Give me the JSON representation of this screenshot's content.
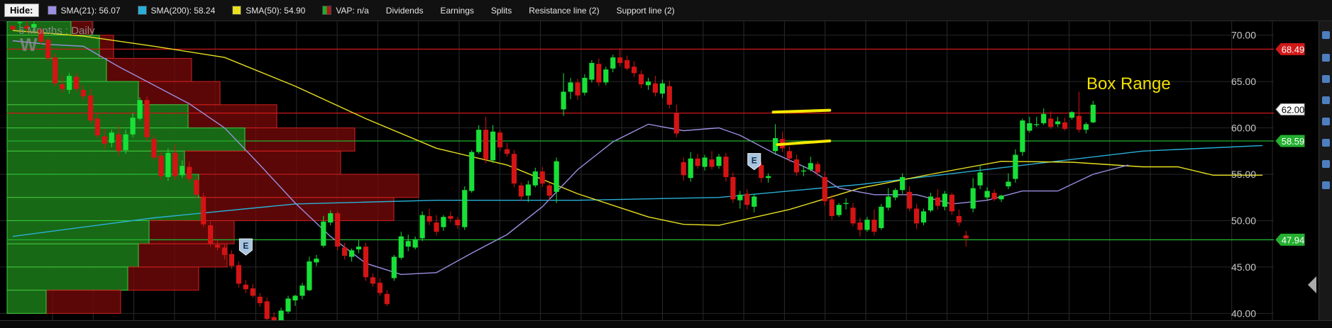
{
  "toolbar": {
    "hide_label": "Hide:",
    "items": [
      {
        "label": "SMA(21): 56.07",
        "color": "#9a8fe0"
      },
      {
        "label": "SMA(200): 58.24",
        "color": "#2ab0d8"
      },
      {
        "label": "SMA(50): 54.90",
        "color": "#e8e020"
      },
      {
        "label": "VAP: n/a",
        "color": "#1fae2a"
      },
      {
        "label": "Dividends"
      },
      {
        "label": "Earnings"
      },
      {
        "label": "Splits"
      },
      {
        "label": "Resistance line (2)"
      },
      {
        "label": "Support line (2)"
      }
    ]
  },
  "chart_data": {
    "type": "candlestick",
    "period_label": "6 Months : Daily",
    "watermark": "W",
    "annotation": "Box Range",
    "earnings_marker_label": "E",
    "ylim": [
      38.5,
      71.5
    ],
    "y_ticks": [
      "70.00",
      "65.00",
      "60.00",
      "55.00",
      "50.00",
      "45.00",
      "40.00"
    ],
    "y_tick_values": [
      70,
      65,
      60,
      55,
      50,
      45,
      40
    ],
    "price_tags": [
      {
        "label": "68.49",
        "value": 68.49,
        "color": "#d01818"
      },
      {
        "label": "62.00",
        "value": 62.0,
        "color": "#ffffff"
      },
      {
        "label": "58.59",
        "value": 58.59,
        "color": "#24b030"
      },
      {
        "label": "47.94",
        "value": 47.94,
        "color": "#24b030"
      }
    ],
    "resistance_lines": [
      68.49,
      61.6
    ],
    "support_lines": [
      58.59,
      47.94
    ],
    "earnings_markers": [
      {
        "index": 33,
        "price": 47.2
      },
      {
        "index": 105,
        "price": 56.4
      }
    ],
    "box_range_lines": [
      {
        "x0": 107.7,
        "x1": 115.7,
        "y0": 61.7,
        "y1": 61.9
      },
      {
        "x0": 108.3,
        "x1": 115.7,
        "y0": 58.2,
        "y1": 58.6
      }
    ],
    "vap": [
      {
        "low": 70,
        "high": 71.5,
        "up": 90,
        "down": 120
      },
      {
        "low": 67.5,
        "high": 70,
        "up": 130,
        "down": 150
      },
      {
        "low": 65,
        "high": 67.5,
        "up": 140,
        "down": 260
      },
      {
        "low": 62.5,
        "high": 65,
        "up": 185,
        "down": 300
      },
      {
        "low": 60,
        "high": 62.5,
        "up": 255,
        "down": 380
      },
      {
        "low": 57.5,
        "high": 60,
        "up": 335,
        "down": 490
      },
      {
        "low": 55,
        "high": 57.5,
        "up": 250,
        "down": 470
      },
      {
        "low": 52.5,
        "high": 55,
        "up": 270,
        "down": 580
      },
      {
        "low": 50,
        "high": 52.5,
        "up": 275,
        "down": 545
      },
      {
        "low": 47.5,
        "high": 50,
        "up": 200,
        "down": 320
      },
      {
        "low": 45,
        "high": 47.5,
        "up": 185,
        "down": 310
      },
      {
        "low": 42.5,
        "high": 45,
        "up": 170,
        "down": 270
      },
      {
        "low": 40,
        "high": 42.5,
        "up": 55,
        "down": 160
      }
    ],
    "candles": [
      [
        71,
        72,
        71.5,
        70.6
      ],
      [
        71.3,
        71.8,
        70.8,
        71.4
      ],
      [
        71,
        71.5,
        70.3,
        70.7
      ],
      [
        70.8,
        71.6,
        70.4,
        71.2
      ],
      [
        70.6,
        70.9,
        69,
        69.3
      ],
      [
        69.5,
        69.8,
        67.2,
        67.5
      ],
      [
        67.6,
        68,
        64.5,
        64.8
      ],
      [
        64.7,
        65.6,
        63.8,
        64.2
      ],
      [
        64.1,
        65.9,
        63.7,
        65.6
      ],
      [
        65.5,
        65.9,
        63.9,
        64.2
      ],
      [
        64.1,
        64.6,
        63,
        63.4
      ],
      [
        63.5,
        64.2,
        60.5,
        60.8
      ],
      [
        61,
        61.6,
        58.9,
        59.2
      ],
      [
        59.1,
        59.9,
        57.8,
        58.3
      ],
      [
        58.4,
        59.8,
        57.9,
        59.5
      ],
      [
        59.3,
        60.2,
        57,
        57.5
      ],
      [
        57.6,
        59.8,
        57.2,
        59.3
      ],
      [
        59.3,
        61.6,
        59,
        61.1
      ],
      [
        61,
        63.3,
        60.8,
        63
      ],
      [
        63,
        63.4,
        58.6,
        59
      ],
      [
        58.8,
        59.2,
        56.5,
        56.8
      ],
      [
        57,
        57.4,
        54.4,
        54.8
      ],
      [
        54.7,
        57.8,
        54.3,
        57.3
      ],
      [
        57.3,
        58.2,
        54.4,
        54.8
      ],
      [
        54.9,
        56.5,
        54.6,
        55.9
      ],
      [
        55.8,
        56.4,
        54.1,
        54.5
      ],
      [
        54.4,
        54.8,
        52.4,
        52.8
      ],
      [
        52.6,
        53,
        49.3,
        49.6
      ],
      [
        49.5,
        49.9,
        47.2,
        47.5
      ],
      [
        47.4,
        47.9,
        46.8,
        47.1
      ],
      [
        47.1,
        47.4,
        45.8,
        46.3
      ],
      [
        46.4,
        46.8,
        44.8,
        45.1
      ],
      [
        45.2,
        45.6,
        42.8,
        43.2
      ],
      [
        43.1,
        43.6,
        42.2,
        42.6
      ],
      [
        42.7,
        43.2,
        41.7,
        41.9
      ],
      [
        41.8,
        42.2,
        40.7,
        41.1
      ],
      [
        41.3,
        41.7,
        39,
        39.4
      ],
      [
        39.6,
        40.1,
        38.4,
        38.8
      ],
      [
        38.9,
        40.6,
        38.7,
        40.3
      ],
      [
        40.2,
        41.9,
        40,
        41.6
      ],
      [
        41.4,
        42,
        40.8,
        41.9
      ],
      [
        41.9,
        43.3,
        41.5,
        43
      ],
      [
        42.5,
        46.1,
        42.4,
        45.6
      ],
      [
        45.5,
        46.3,
        45.1,
        45.9
      ],
      [
        47.3,
        50.5,
        47.1,
        49.9
      ],
      [
        49.8,
        51.1,
        49.5,
        50.8
      ],
      [
        50.8,
        51,
        46.8,
        47.2
      ],
      [
        47.1,
        47.6,
        45.8,
        46.2
      ],
      [
        46.1,
        47,
        45.6,
        46.8
      ],
      [
        46.9,
        47.9,
        46.5,
        47.2
      ],
      [
        47.2,
        47.6,
        43.5,
        43.9
      ],
      [
        43.9,
        44.3,
        42.9,
        43.2
      ],
      [
        43.3,
        43.8,
        41.9,
        42.2
      ],
      [
        42.1,
        42.5,
        40.8,
        41
      ],
      [
        43.8,
        46.3,
        43.5,
        46.1
      ],
      [
        46,
        48.8,
        45.8,
        48.3
      ],
      [
        47.2,
        48.5,
        46.7,
        47.8
      ],
      [
        47.1,
        48.3,
        46.9,
        48
      ],
      [
        48.1,
        51,
        47.8,
        50.6
      ],
      [
        50.5,
        51.3,
        49.5,
        49.9
      ],
      [
        49.8,
        50.6,
        48.4,
        48.8
      ],
      [
        49.3,
        50.6,
        48.9,
        50.4
      ],
      [
        50.5,
        51,
        49.8,
        50.2
      ],
      [
        50.1,
        50.4,
        49.1,
        49.5
      ],
      [
        49.3,
        53.7,
        49,
        53.3
      ],
      [
        53.2,
        57.6,
        53,
        57.4
      ],
      [
        57.4,
        60.3,
        57.2,
        59.8
      ],
      [
        59.8,
        61.2,
        56.2,
        56.6
      ],
      [
        56.5,
        60.3,
        56.2,
        59.6
      ],
      [
        59.5,
        59.8,
        57.5,
        57.9
      ],
      [
        57.7,
        58.4,
        56.9,
        57.2
      ],
      [
        57.2,
        57.6,
        53.6,
        54
      ],
      [
        53.8,
        54.1,
        52.1,
        52.6
      ],
      [
        52.7,
        54.3,
        52,
        53.9
      ],
      [
        53.8,
        55.7,
        53.6,
        55.3
      ],
      [
        55.3,
        55.8,
        53.6,
        54
      ],
      [
        53.8,
        54.1,
        52.2,
        52.7
      ],
      [
        53.1,
        56.8,
        51.9,
        56.4
      ],
      [
        62,
        65.9,
        61.3,
        63.9
      ],
      [
        63.9,
        65.4,
        63.1,
        64.9
      ],
      [
        64.9,
        65.3,
        63,
        63.5
      ],
      [
        63.8,
        65.8,
        63.5,
        65.4
      ],
      [
        65.2,
        67.3,
        64.9,
        67
      ],
      [
        66.9,
        67.5,
        64.5,
        64.9
      ],
      [
        64.9,
        66.6,
        64.6,
        66.3
      ],
      [
        66.4,
        67.9,
        66,
        67.6
      ],
      [
        67.6,
        68.6,
        66.6,
        67
      ],
      [
        67.3,
        67.8,
        66.2,
        66.4
      ],
      [
        66.6,
        67.2,
        65.5,
        65.9
      ],
      [
        65.8,
        66.2,
        64.3,
        64.7
      ],
      [
        64.6,
        65.4,
        64.1,
        65
      ],
      [
        64.8,
        65.6,
        63.4,
        63.8
      ],
      [
        63.7,
        65.2,
        63.2,
        64.8
      ],
      [
        64.5,
        65.1,
        62.1,
        62.5
      ],
      [
        61.6,
        62.5,
        59,
        59.4
      ],
      [
        56.3,
        56.8,
        54.3,
        54.9
      ],
      [
        54.6,
        57.4,
        54.2,
        56.7
      ],
      [
        56.7,
        57.2,
        55.6,
        55.9
      ],
      [
        55.8,
        57.1,
        55.4,
        56.8
      ],
      [
        56.6,
        57.5,
        55.5,
        55.8
      ],
      [
        55.9,
        57.2,
        55.6,
        56.9
      ],
      [
        56.9,
        57.3,
        54.2,
        54.7
      ],
      [
        54.7,
        55.2,
        51.9,
        52.3
      ],
      [
        52.2,
        53.2,
        51.3,
        52.8
      ],
      [
        52.9,
        53.4,
        51.2,
        51.7
      ],
      [
        51.5,
        52.9,
        50.9,
        52.6
      ],
      [
        56,
        56.3,
        54.1,
        54.6
      ],
      [
        54.6,
        55.1,
        54.1,
        54.8
      ],
      [
        57.5,
        60.4,
        57.1,
        58.9
      ],
      [
        58.8,
        59.6,
        57.4,
        57.8
      ],
      [
        57.5,
        58,
        56.3,
        56.7
      ],
      [
        56.6,
        57.1,
        54.8,
        55.2
      ],
      [
        55.3,
        55.9,
        54.8,
        55.4
      ],
      [
        55.5,
        56.9,
        55.3,
        56.2
      ],
      [
        56.1,
        56.4,
        54.8,
        55.2
      ],
      [
        54.7,
        55.3,
        51.6,
        52.1
      ],
      [
        52.3,
        52.8,
        50.1,
        50.5
      ],
      [
        50.6,
        51.9,
        50.4,
        51.7
      ],
      [
        51.8,
        52.4,
        51.2,
        51.9
      ],
      [
        51.4,
        51.9,
        49.4,
        49.7
      ],
      [
        49.8,
        50.3,
        48.3,
        49
      ],
      [
        49,
        50.4,
        48.8,
        50.1
      ],
      [
        50.1,
        51.2,
        48.4,
        48.8
      ],
      [
        49.2,
        51.8,
        49,
        51.5
      ],
      [
        51.4,
        53.5,
        51.1,
        52.6
      ],
      [
        52.5,
        53.5,
        52.2,
        53.3
      ],
      [
        53.3,
        55.1,
        52.9,
        54.7
      ],
      [
        53.1,
        53.7,
        51,
        51.3
      ],
      [
        51.3,
        51.8,
        49.1,
        49.7
      ],
      [
        49.8,
        51.3,
        49.5,
        51
      ],
      [
        51.1,
        53,
        50.9,
        52.6
      ],
      [
        52.5,
        53.4,
        51.2,
        51.6
      ],
      [
        51.5,
        53.2,
        51.1,
        52.9
      ],
      [
        52.8,
        53,
        50.6,
        51
      ],
      [
        50.5,
        51.2,
        49.4,
        49.8
      ],
      [
        48.4,
        48.9,
        47.2,
        48.1
      ],
      [
        51.3,
        54.6,
        50.9,
        53.5
      ],
      [
        53.8,
        56,
        53.4,
        55.2
      ],
      [
        52.5,
        53.6,
        52.2,
        53.2
      ],
      [
        53,
        53.4,
        52.1,
        52.3
      ],
      [
        52.3,
        52.8,
        52,
        52.7
      ],
      [
        53.7,
        55.1,
        53.4,
        54.2
      ],
      [
        54.5,
        57.7,
        54.1,
        57.1
      ],
      [
        57.4,
        61,
        57,
        60.8
      ],
      [
        59.7,
        61.2,
        59.5,
        60.5
      ],
      [
        60.3,
        61.2,
        60.1,
        60.4
      ],
      [
        60.5,
        62.1,
        60.3,
        61.5
      ],
      [
        61,
        61.8,
        59.9,
        60.1
      ],
      [
        60.4,
        61.2,
        60.1,
        60.7
      ],
      [
        60.6,
        61.1,
        59.7,
        59.9
      ],
      [
        61.1,
        61.8,
        60.9,
        61.7
      ],
      [
        61.3,
        63.9,
        59.5,
        59.8
      ],
      [
        59.8,
        60.6,
        59.4,
        60.4
      ],
      [
        60.6,
        62.9,
        60.5,
        62.5
      ]
    ],
    "sma21": [
      [
        0,
        69.4
      ],
      [
        5,
        69
      ],
      [
        10,
        68.8
      ],
      [
        15,
        66.6
      ],
      [
        20,
        64.6
      ],
      [
        25,
        62.6
      ],
      [
        30,
        60
      ],
      [
        35,
        56
      ],
      [
        40,
        51.9
      ],
      [
        45,
        48.3
      ],
      [
        50,
        45.4
      ],
      [
        55,
        44.2
      ],
      [
        60,
        44.4
      ],
      [
        65,
        46.5
      ],
      [
        70,
        48.5
      ],
      [
        75,
        51.5
      ],
      [
        80,
        55.5
      ],
      [
        85,
        58.5
      ],
      [
        90,
        60.4
      ],
      [
        95,
        59.7
      ],
      [
        100,
        60
      ],
      [
        103,
        59.2
      ],
      [
        108,
        57.2
      ],
      [
        113,
        55.5
      ],
      [
        117,
        53.5
      ],
      [
        122,
        52.8
      ],
      [
        128,
        52.8
      ],
      [
        133,
        51.8
      ],
      [
        138,
        52.2
      ],
      [
        143,
        53.2
      ],
      [
        148,
        53.2
      ],
      [
        153,
        55
      ],
      [
        158,
        56
      ]
    ],
    "sma50": [
      [
        0,
        70.5
      ],
      [
        10,
        69.9
      ],
      [
        20,
        68.8
      ],
      [
        30,
        67.6
      ],
      [
        40,
        64.5
      ],
      [
        50,
        61
      ],
      [
        60,
        57.8
      ],
      [
        70,
        56
      ],
      [
        80,
        52.9
      ],
      [
        90,
        50.4
      ],
      [
        95,
        49.6
      ],
      [
        100,
        49.5
      ],
      [
        110,
        51.2
      ],
      [
        120,
        53.5
      ],
      [
        130,
        55
      ],
      [
        140,
        56.4
      ],
      [
        150,
        56.3
      ],
      [
        160,
        55.8
      ],
      [
        165,
        55.8
      ],
      [
        170,
        54.9
      ],
      [
        177,
        54.9
      ]
    ],
    "sma200": [
      [
        0,
        48.3
      ],
      [
        20,
        50.3
      ],
      [
        40,
        51.8
      ],
      [
        60,
        52.2
      ],
      [
        80,
        52.2
      ],
      [
        100,
        52.5
      ],
      [
        120,
        53.9
      ],
      [
        140,
        55.7
      ],
      [
        160,
        57.5
      ],
      [
        177,
        58.1
      ]
    ]
  }
}
